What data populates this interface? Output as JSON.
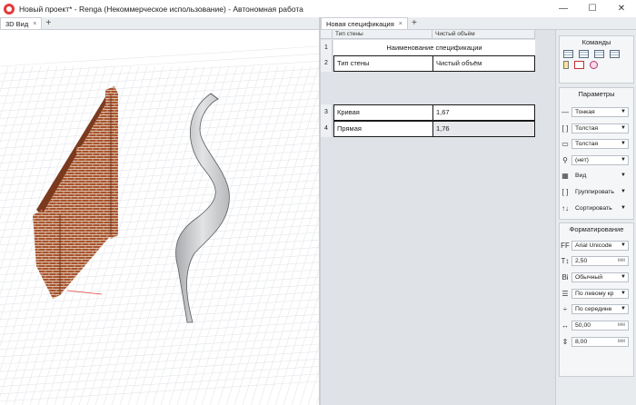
{
  "window": {
    "title": "Новый проект* - Renga (Некоммерческое использование) - Автономная работа",
    "minimize_glyph": "—",
    "maximize_glyph": "☐",
    "close_glyph": "✕"
  },
  "left_tabs": [
    {
      "label": "3D Вид",
      "close": "×"
    }
  ],
  "right_tabs": [
    {
      "label": "Новая спецификация",
      "close": "×"
    }
  ],
  "add_tab_glyph": "+",
  "spec": {
    "columns": [
      "Тип стены",
      "Чистый объём"
    ],
    "row1_number": "1",
    "row1_title": "Наименование спецификации",
    "row2_number": "2",
    "row2_cells": [
      "Тип стены",
      "Чистый объём"
    ],
    "rows": [
      {
        "num": "3",
        "type": "Кривая",
        "volume": "1,67"
      },
      {
        "num": "4",
        "type": "Прямая",
        "volume": "1,76"
      }
    ]
  },
  "panel": {
    "commands_title": "Команды",
    "parameters_title": "Параметры",
    "parameters": [
      {
        "icon": "thin-line-icon",
        "value": "Тонкая"
      },
      {
        "icon": "thick-bracket-icon",
        "value": "Толстая"
      },
      {
        "icon": "thick-box-icon",
        "value": "Толстая"
      },
      {
        "icon": "filter-icon",
        "value": "(нет)"
      },
      {
        "icon": "view-icon",
        "value": "Вид"
      },
      {
        "icon": "group-icon",
        "value": "Группировать"
      },
      {
        "icon": "sort-icon",
        "value": "Сортировать"
      }
    ],
    "formatting_title": "Форматирование",
    "formatting": [
      {
        "icon": "font-family-icon",
        "value": "Arial Unicode",
        "unit": ""
      },
      {
        "icon": "font-size-icon",
        "value": "2,50",
        "unit": "мм"
      },
      {
        "icon": "font-style-icon",
        "value": "Обычный",
        "unit": ""
      },
      {
        "icon": "align-horizontal-icon",
        "value": "По левому кр",
        "unit": ""
      },
      {
        "icon": "align-vertical-icon",
        "value": "По середине",
        "unit": ""
      },
      {
        "icon": "column-width-icon",
        "value": "50,00",
        "unit": "мм"
      },
      {
        "icon": "row-height-icon",
        "value": "8,00",
        "unit": "мм"
      }
    ],
    "icon_glyphs": {
      "font_family": "FF",
      "font_size": "T↕",
      "font_style": "Bi",
      "sort": "↑↓"
    }
  },
  "colors": {
    "brick": "#a9532c",
    "mortar": "#e2d6c8",
    "curved_wall": "#c9cbcd",
    "grid_line": "#e3e6ea",
    "axis_red": "#e53b3b"
  }
}
